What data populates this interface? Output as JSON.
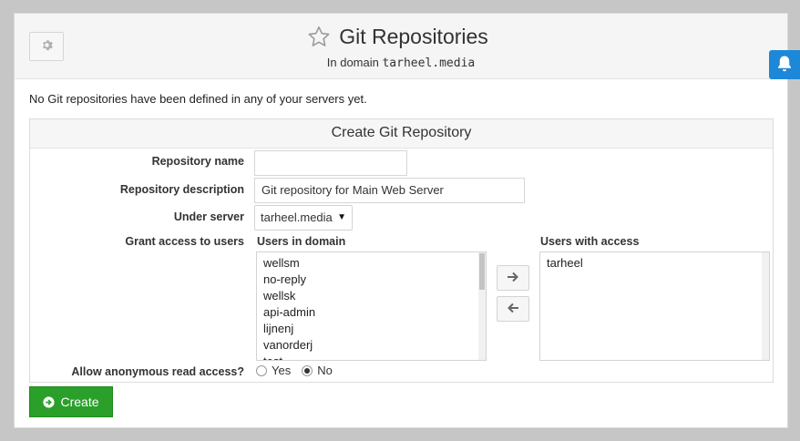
{
  "header": {
    "title": "Git Repositories",
    "subtitle_prefix": "In domain",
    "domain": "tarheel.media"
  },
  "notice": "No Git repositories have been defined in any of your servers yet.",
  "form": {
    "heading": "Create Git Repository",
    "repo_name_label": "Repository name",
    "repo_name_value": "",
    "repo_desc_label": "Repository description",
    "repo_desc_value": "Git repository for Main Web Server",
    "server_label": "Under server",
    "server_value": "tarheel.media",
    "grant_label": "Grant access to users",
    "users_in_domain_label": "Users in domain",
    "users_in_domain": [
      "wellsm",
      "no-reply",
      "wellsk",
      "api-admin",
      "lijnenj",
      "vanorderj",
      "test"
    ],
    "users_with_access_label": "Users with access",
    "users_with_access": [
      "tarheel"
    ],
    "anon_label": "Allow anonymous read access?",
    "anon_options": [
      "Yes",
      "No"
    ],
    "anon_selected": "No"
  },
  "actions": {
    "create_label": "Create"
  },
  "colors": {
    "accent_green": "#2aa02a",
    "notification_blue": "#1e88d8"
  },
  "icons": [
    "gear-icon",
    "star-icon",
    "bell-icon",
    "arrow-right-icon",
    "arrow-left-icon",
    "circle-arrow-right-icon"
  ]
}
